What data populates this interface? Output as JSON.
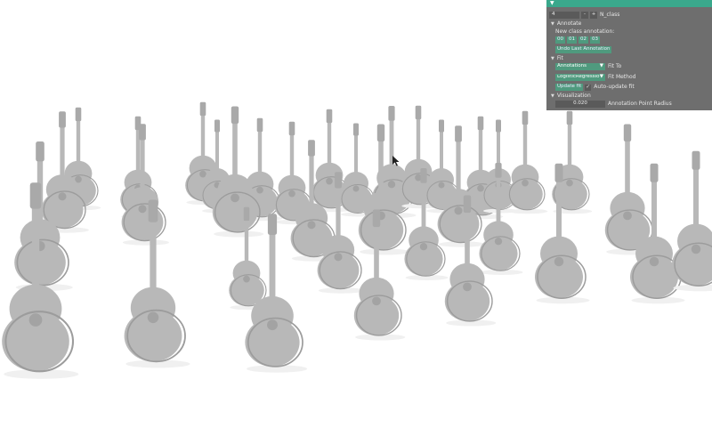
{
  "panel": {
    "collapse_icon": "triangle-down-icon",
    "n_class": {
      "value": "4",
      "minus": "-",
      "plus": "+",
      "label": "N_class"
    },
    "annotate": {
      "header": "Annotate",
      "new_class_label": "New class annotation:",
      "class_buttons": [
        "00",
        "01",
        "02",
        "03"
      ],
      "undo_label": "Undo Last Annotation"
    },
    "fit": {
      "header": "Fit",
      "fit_to_value": "Annotations",
      "fit_to_label": "Fit To",
      "fit_method_value": "LogisticRegressior",
      "fit_method_label": "Fit Method",
      "update_label": "Update fit",
      "autoupdate_label": "Auto-update fit",
      "autoupdate_checked": true
    },
    "visualization": {
      "header": "Visualization",
      "radius_value": "0.020",
      "radius_label": "Annotation Point Radius"
    }
  },
  "scene": {
    "background": "#ffffff",
    "guitar_color": "#b8b8b8",
    "accent_color": "#3aa88c"
  }
}
